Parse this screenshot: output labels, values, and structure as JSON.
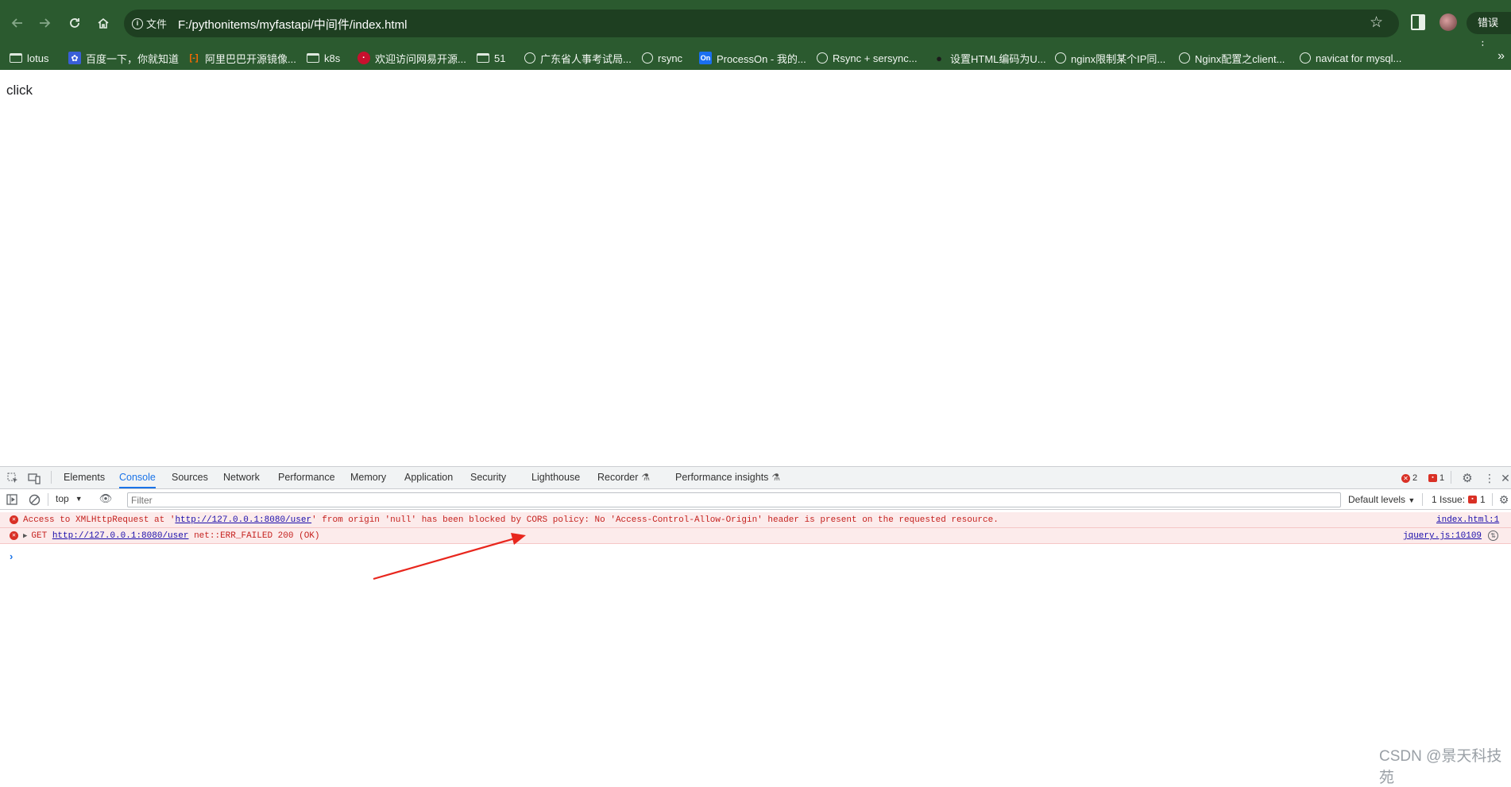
{
  "browser": {
    "site_info_label": "文件",
    "url": "F:/pythonitems/myfastapi/中间件/index.html",
    "error_pill": "错误"
  },
  "bookmarks": [
    {
      "label": "lotus",
      "icon": "folder-icon"
    },
    {
      "label": "百度一下，你就知道",
      "icon": "baidu-icon"
    },
    {
      "label": "阿里巴巴开源镜像...",
      "icon": "aliyun-icon"
    },
    {
      "label": "k8s",
      "icon": "folder-icon"
    },
    {
      "label": "欢迎访问网易开源...",
      "icon": "netease-icon"
    },
    {
      "label": "51",
      "icon": "folder-icon"
    },
    {
      "label": "广东省人事考试局...",
      "icon": "globe-icon"
    },
    {
      "label": "rsync",
      "icon": "globe-icon"
    },
    {
      "label": "ProcessOn - 我的...",
      "icon": "processon-icon",
      "icon_text": "On"
    },
    {
      "label": "Rsync + sersync...",
      "icon": "globe-icon"
    },
    {
      "label": "设置HTML编码为U...",
      "icon": "github-icon"
    },
    {
      "label": "nginx限制某个IP同...",
      "icon": "globe-icon"
    },
    {
      "label": "Nginx配置之client...",
      "icon": "globe-icon"
    },
    {
      "label": "navicat for mysql...",
      "icon": "globe-icon"
    }
  ],
  "page": {
    "text": "click"
  },
  "devtools": {
    "tabs": [
      "Elements",
      "Console",
      "Sources",
      "Network",
      "Performance",
      "Memory",
      "Application",
      "Security",
      "Lighthouse",
      "Recorder",
      "Performance insights"
    ],
    "active_tab": "Console",
    "error_count": "2",
    "issue_count_badge": "1",
    "context": "top",
    "filter_placeholder": "Filter",
    "levels": "Default levels",
    "issues_label": "1 Issue:",
    "issues_count": "1",
    "messages": [
      {
        "pre": "Access to XMLHttpRequest at '",
        "link": "http://127.0.0.1:8080/user",
        "post": "' from origin 'null' has been blocked by CORS policy: No 'Access-Control-Allow-Origin' header is present on the requested resource.",
        "source": "index.html:1"
      },
      {
        "pre": "GET ",
        "link": "http://127.0.0.1:8080/user",
        "post": " net::ERR_FAILED 200 (OK)",
        "source": "jquery.js:10109"
      }
    ],
    "prompt": "›"
  },
  "watermark": "CSDN @景天科技苑",
  "colors": {
    "chrome_bg": "#2b5a2f",
    "omnibox_bg": "#1e3f21",
    "devtools_accent": "#1a73e8",
    "error_red": "#d93025",
    "error_row_bg": "#fcebeb"
  }
}
